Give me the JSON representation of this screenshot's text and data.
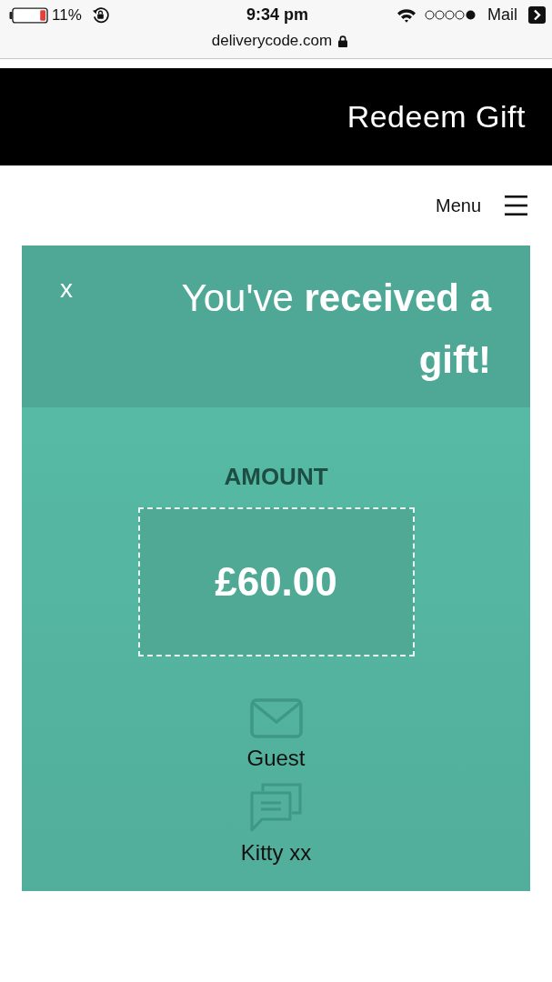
{
  "status_bar": {
    "back_app": "Mail",
    "time": "9:34 pm",
    "battery": "11%"
  },
  "address_bar": {
    "url": "deliverycode.com"
  },
  "header": {
    "title": "Redeem Gift"
  },
  "nav": {
    "menu_label": "Menu"
  },
  "gift_card": {
    "title": "You've **received a gift!**",
    "close": "x",
    "amount_label": "AMOUNT",
    "amount": "£60.00",
    "details": [
      {
        "kind": "email",
        "text": "Guest"
      },
      {
        "kind": "message",
        "text": "Kitty xx"
      }
    ]
  }
}
